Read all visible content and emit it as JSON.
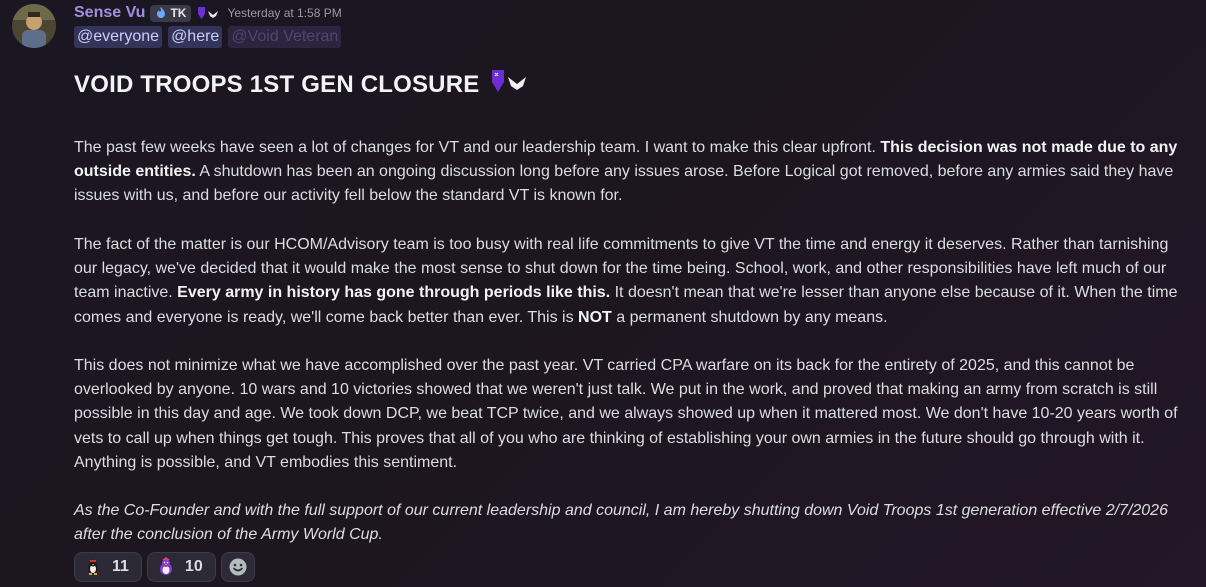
{
  "message": {
    "author": {
      "name": "Sense Vu",
      "tag": "TK"
    },
    "timestamp": "Yesterday at 1:58 PM",
    "mentions": [
      "@everyone",
      "@here",
      "@Void Veteran"
    ],
    "title": "VOID TROOPS 1ST GEN CLOSURE",
    "paragraphs": [
      [
        {
          "t": "The past few weeks have seen a lot of changes for VT and our leadership team. I want to make this clear upfront. "
        },
        {
          "t": "This decision was not made due to any outside entities.",
          "b": true
        },
        {
          "t": " A shutdown has been an ongoing discussion long before any issues arose. Before Logical got removed, before any armies said they have issues with us, and before our activity fell below the standard VT is known for."
        }
      ],
      [
        {
          "t": "The fact of the matter is our HCOM/Advisory team is too busy with real life commitments to give VT the time and energy it deserves. Rather than tarnishing our legacy, we've decided that it would make the most sense to shut down for the time being. School, work, and other responsibilities have left much of our team inactive. "
        },
        {
          "t": "Every army in history has gone through periods like this.",
          "b": true
        },
        {
          "t": " It doesn't mean that we're lesser than anyone else because of it. When the time comes and everyone is ready, we'll come back better than ever. This is "
        },
        {
          "t": "NOT",
          "b": true
        },
        {
          "t": " a permanent shutdown by any means."
        }
      ],
      [
        {
          "t": "This does not minimize what we have accomplished over the past year. VT carried CPA warfare on its back for the entirety of 2025, and this cannot be overlooked by anyone. 10 wars and 10 victories showed that we weren't just talk. We put in the work, and proved that making an army from scratch is still possible in this day and age. We took down DCP, we beat TCP twice, and we always showed up when it mattered most. We don't have 10-20 years worth of vets to call up when things get tough. This proves that all of you who are thinking of establishing your own armies in the future should go through with it. Anything is possible, and VT embodies this sentiment."
        }
      ],
      [
        {
          "t": "As the Co-Founder and with the full support of our current leadership and council, I am hereby shutting down Void Troops 1st generation effective 2/7/2026 after the conclusion of the Army World Cup."
        }
      ]
    ],
    "reactions": [
      {
        "emoji": "penguin-icon",
        "count": "11"
      },
      {
        "emoji": "purple-penguin-icon",
        "count": "10"
      }
    ],
    "colors": {
      "accent": "#a08fe0",
      "mention_bg": "#34345a",
      "background": "#1c1620"
    }
  }
}
